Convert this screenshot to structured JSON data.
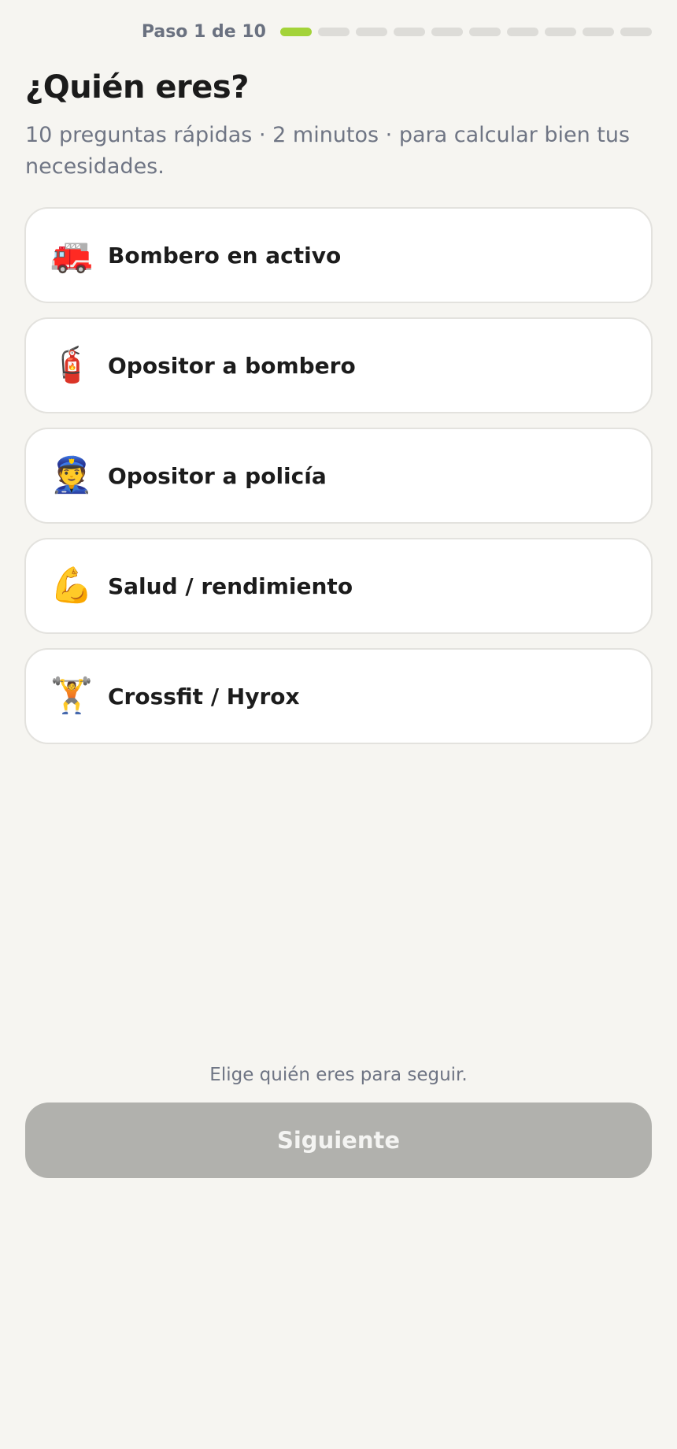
{
  "progress": {
    "label": "Paso 1 de 10",
    "current_step": 1,
    "total_steps": 10,
    "active_color": "#a3d339",
    "inactive_color": "#dddcd8"
  },
  "header": {
    "title": "¿Quién eres?",
    "subtitle": "10 preguntas rápidas · 2 minutos · para calcular bien tus necesidades."
  },
  "options": [
    {
      "icon": "fire-engine-icon",
      "glyph": "🚒",
      "label": "Bombero en activo"
    },
    {
      "icon": "fire-extinguisher-icon",
      "glyph": "🧯",
      "label": "Opositor a bombero"
    },
    {
      "icon": "police-officer-icon",
      "glyph": "👮",
      "label": "Opositor a policía"
    },
    {
      "icon": "flexed-biceps-icon",
      "glyph": "💪",
      "label": "Salud / rendimiento"
    },
    {
      "icon": "weight-lifter-icon",
      "glyph": "🏋️",
      "label": "Crossfit / Hyrox"
    }
  ],
  "footer": {
    "hint": "Elige quién eres para seguir.",
    "next_label": "Siguiente",
    "next_enabled": false,
    "next_color": "#b1b1ad"
  }
}
